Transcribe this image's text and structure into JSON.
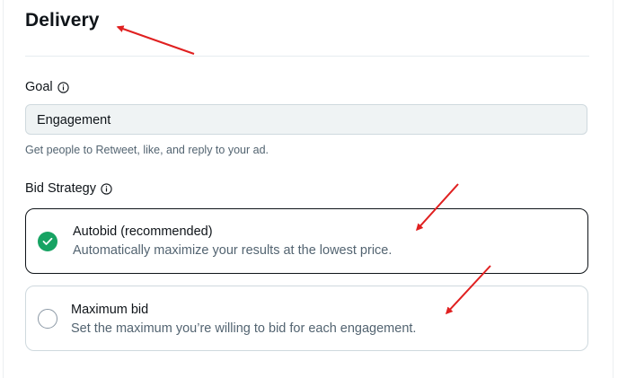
{
  "header": {
    "title": "Delivery"
  },
  "goal": {
    "label": "Goal",
    "value": "Engagement",
    "help_text": "Get people to Retweet, like, and reply to your ad."
  },
  "bid_strategy": {
    "label": "Bid Strategy",
    "options": [
      {
        "title": "Autobid (recommended)",
        "description": "Automatically maximize your results at the lowest price.",
        "selected": true
      },
      {
        "title": "Maximum bid",
        "description": "Set the maximum you’re willing to bid for each engagement.",
        "selected": false
      }
    ]
  },
  "icons": {
    "info": "info-circle-icon",
    "check": "checkmark-icon"
  },
  "colors": {
    "selected_radio": "#17a363",
    "annotation_arrow": "#e02020",
    "input_background": "#eff3f4",
    "secondary_text": "#536471"
  }
}
